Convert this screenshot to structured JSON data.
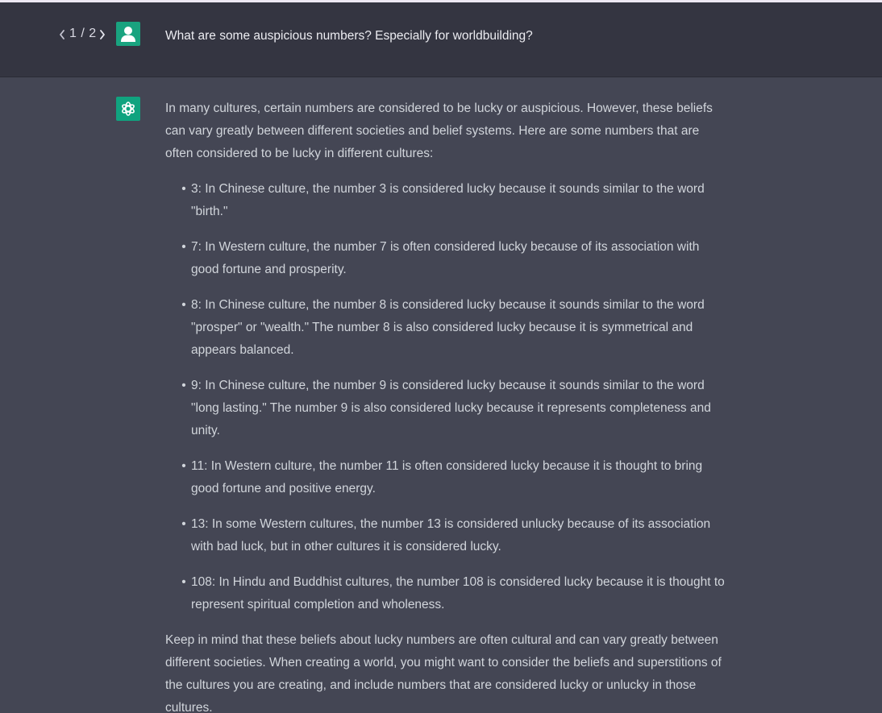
{
  "colors": {
    "user_row_bg": "#343541",
    "assistant_row_bg": "#444654",
    "avatar_green": "#19a37f",
    "text": "#d1d5db"
  },
  "pager": {
    "prev_icon": "chevron-left-icon",
    "count": "1 / 2",
    "next_icon": "chevron-right-icon"
  },
  "user": {
    "avatar_icon": "user-icon",
    "message": "What are some auspicious numbers? Especially for worldbuilding?"
  },
  "assistant": {
    "avatar_icon": "openai-logo-icon",
    "intro": "In many cultures, certain numbers are considered to be lucky or auspicious. However, these beliefs can vary greatly between different societies and belief systems. Here are some numbers that are often considered to be lucky in different cultures:",
    "items": [
      {
        "text": "3: In Chinese culture, the number 3 is considered lucky because it sounds similar to the word \"birth.\""
      },
      {
        "text": "7: In Western culture, the number 7 is often considered lucky because of its association with good fortune and prosperity."
      },
      {
        "text": "8: In Chinese culture, the number 8 is considered lucky because it sounds similar to the word \"prosper\" or \"wealth.\" The number 8 is also considered lucky because it is symmetrical and appears balanced."
      },
      {
        "text": "9: In Chinese culture, the number 9 is considered lucky because it sounds similar to the word \"long lasting.\" The number 9 is also considered lucky because it represents completeness and unity."
      },
      {
        "text": "11: In Western culture, the number 11 is often considered lucky because it is thought to bring good fortune and positive energy."
      },
      {
        "text": "13: In some Western cultures, the number 13 is considered unlucky because of its association with bad luck, but in other cultures it is considered lucky."
      },
      {
        "text": "108: In Hindu and Buddhist cultures, the number 108 is considered lucky because it is thought to represent spiritual completion and wholeness."
      }
    ],
    "outro": "Keep in mind that these beliefs about lucky numbers are often cultural and can vary greatly between different societies. When creating a world, you might want to consider the beliefs and superstitions of the cultures you are creating, and include numbers that are considered lucky or unlucky in those cultures."
  }
}
